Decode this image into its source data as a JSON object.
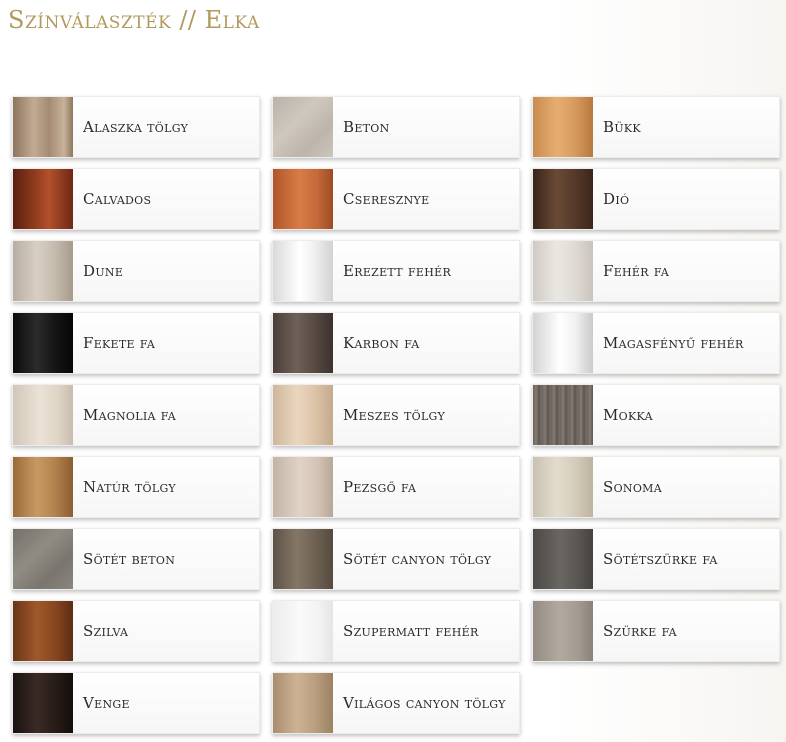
{
  "page": {
    "title": "Színválaszték // Elka"
  },
  "colors": [
    {
      "name": "Alaszka tölgy",
      "swatch": "linear-gradient(90deg,#8d7560 0%,#c2ab93 35%,#a48a72 60%,#c8b29b 85%,#8e775f 100%)"
    },
    {
      "name": "Beton",
      "swatch": "linear-gradient(135deg,#b9b2a8 0%,#cfc8bf 40%,#bdb5aa 70%,#cbc4ba 100%)"
    },
    {
      "name": "Bükk",
      "swatch": "linear-gradient(90deg,#c98b4e 0%,#e6ad72 40%,#d69a5d 70%,#b9793e 100%)"
    },
    {
      "name": "Calvados",
      "swatch": "linear-gradient(90deg,#5a1f0f 0%,#8e3a1d 35%,#b1512a 60%,#6e2814 100%)"
    },
    {
      "name": "Cseresznye",
      "swatch": "linear-gradient(90deg,#b0562a 0%,#d97c46 45%,#c2683a 75%,#9f4b22 100%)"
    },
    {
      "name": "Dió",
      "swatch": "linear-gradient(90deg,#3a2518 0%,#6a4a36 40%,#55392a 70%,#3b261a 100%)"
    },
    {
      "name": "Dune",
      "swatch": "linear-gradient(90deg,#b8ada0 0%,#d8cfc4 40%,#c5baad 70%,#a89b8c 100%)"
    },
    {
      "name": "Erezett fehér",
      "swatch": "linear-gradient(90deg,#d9d9d9 0%,#ffffff 45%,#efefef 70%,#d2d2d2 100%)"
    },
    {
      "name": "Fehér fa",
      "swatch": "linear-gradient(90deg,#cfcac3 0%,#ebe7e2 40%,#dedad4 70%,#c9c3bb 100%)"
    },
    {
      "name": "Fekete fa",
      "swatch": "linear-gradient(90deg,#0c0c0c 0%,#2b2b2b 40%,#151515 70%,#060606 100%)"
    },
    {
      "name": "Karbon fa",
      "swatch": "linear-gradient(90deg,#4a3f38 0%,#6e6159 40%,#564a42 70%,#3c322c 100%)"
    },
    {
      "name": "Magasfényű fehér",
      "swatch": "linear-gradient(90deg,#d4d4d4 0%,#ffffff 45%,#f1f1f1 70%,#cacaca 100%)"
    },
    {
      "name": "Magnolia fa",
      "swatch": "linear-gradient(90deg,#d2c6b8 0%,#ebe2d6 45%,#dfd4c6 75%,#c9bcad 100%)"
    },
    {
      "name": "Meszes tölgy",
      "swatch": "linear-gradient(90deg,#cdb69c 0%,#ead6bf 40%,#dcc3a8 70%,#c4aa8d 100%)"
    },
    {
      "name": "Mokka",
      "swatch": "repeating-linear-gradient(90deg,#6b625b 0px,#847b73 3px,#5f5650 6px,#7a716a 9px)"
    },
    {
      "name": "Natúr tölgy",
      "swatch": "linear-gradient(90deg,#9a6a3a 0%,#c79a63 40%,#b1824d 70%,#8c5d31 100%)"
    },
    {
      "name": "Pezsgő fa",
      "swatch": "linear-gradient(90deg,#c3b4a6 0%,#e0d3c6 45%,#d2c3b5 75%,#b7a796 100%)"
    },
    {
      "name": "Sonoma",
      "swatch": "linear-gradient(90deg,#c9c1b0 0%,#e3dccd 40%,#d5ccbb 70%,#bcb3a0 100%)"
    },
    {
      "name": "Sötét beton",
      "swatch": "linear-gradient(135deg,#75716a 0%,#908b83 40%,#7a766f 70%,#8a857d 100%)"
    },
    {
      "name": "Sötét canyon tölgy",
      "swatch": "linear-gradient(90deg,#5e5347 0%,#857767 40%,#6f6253 70%,#554a3e 100%)"
    },
    {
      "name": "Sötétszürke fa",
      "swatch": "linear-gradient(90deg,#4c4946 0%,#6a6662 45%,#5a5652 75%,#45423f 100%)"
    },
    {
      "name": "Szilva",
      "swatch": "linear-gradient(90deg,#6a3519 0%,#a0582c 40%,#87471f 70%,#5e2d14 100%)"
    },
    {
      "name": "Szupermatt fehér",
      "swatch": "linear-gradient(90deg,#ececec 0%,#fafafa 45%,#f3f3f3 75%,#e5e5e5 100%)"
    },
    {
      "name": "Szürke fa",
      "swatch": "linear-gradient(90deg,#958b83 0%,#b2a9a1 45%,#a39a91 75%,#8b8178 100%)"
    },
    {
      "name": "Venge",
      "swatch": "linear-gradient(90deg,#1a1210 0%,#3a2a25 40%,#281c18 70%,#140e0c 100%)"
    },
    {
      "name": "Világos canyon tölgy",
      "swatch": "linear-gradient(90deg,#a98d6e 0%,#cdb394 40%,#b99e7f 70%,#9c8163 100%)"
    }
  ]
}
